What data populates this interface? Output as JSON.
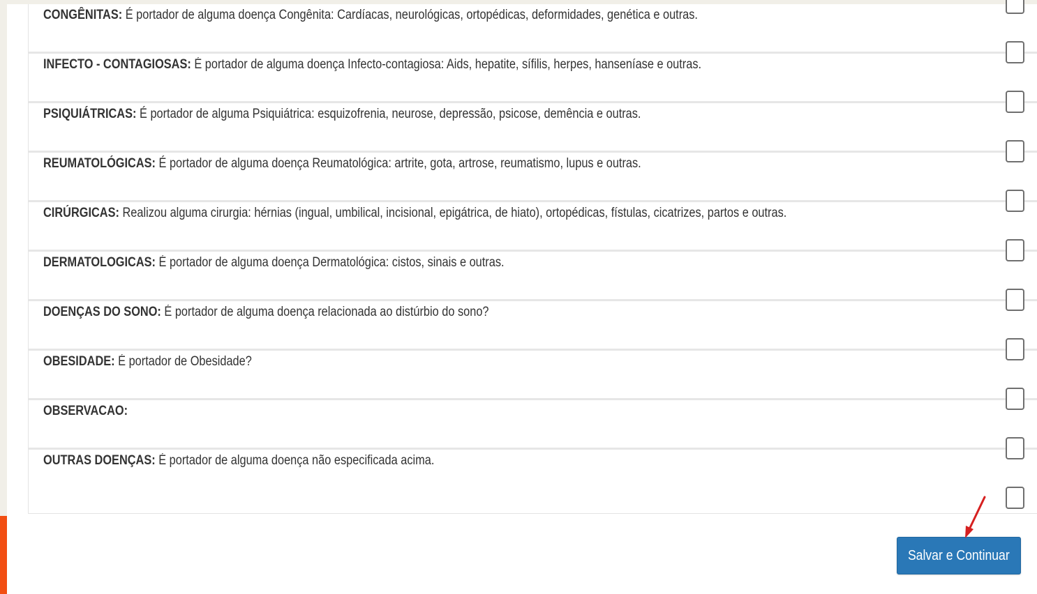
{
  "form": {
    "rows": [
      {
        "label": "CONGÊNITAS:",
        "text": " É portador de alguma doença Congênita: Cardíacas, neurológicas, ortopédicas, deformidades, genética e outras."
      },
      {
        "label": "INFECTO - CONTAGIOSAS:",
        "text": " É portador de alguma doença Infecto-contagiosa: Aids, hepatite, sífilis, herpes, hanseníase e outras."
      },
      {
        "label": "PSIQUIÁTRICAS:",
        "text": " É portador de alguma Psiquiátrica: esquizofrenia, neurose, depressão, psicose, demência e outras."
      },
      {
        "label": "REUMATOLÓGICAS:",
        "text": " É portador de alguma doença Reumatológica: artrite, gota, artrose, reumatismo, lupus e outras."
      },
      {
        "label": "CIRÚRGICAS:",
        "text": " Realizou alguma cirurgia: hérnias (ingual, umbilical, incisional, epigátrica, de hiato), ortopédicas, fístulas, cicatrizes, partos e outras."
      },
      {
        "label": "DERMATOLOGICAS:",
        "text": " É portador de alguma doença Dermatológica: cistos, sinais e outras."
      },
      {
        "label": "DOENÇAS DO SONO:",
        "text": " É portador de alguma doença relacionada ao distúrbio do sono?"
      },
      {
        "label": "OBESIDADE:",
        "text": " É portador de Obesidade?"
      },
      {
        "label": "OBSERVACAO:",
        "text": ""
      },
      {
        "label": "OUTRAS DOENÇAS:",
        "text": " É portador de alguma doença não especificada acima."
      }
    ],
    "checkboxes_checked": [
      false,
      false,
      false,
      false,
      false,
      false,
      false,
      false,
      false,
      false,
      false
    ]
  },
  "actions": {
    "submit_label": "Salvar e Continuar"
  },
  "colors": {
    "button": "#2a78b7",
    "accent_bar": "#f24e12",
    "arrow": "#d62020"
  }
}
